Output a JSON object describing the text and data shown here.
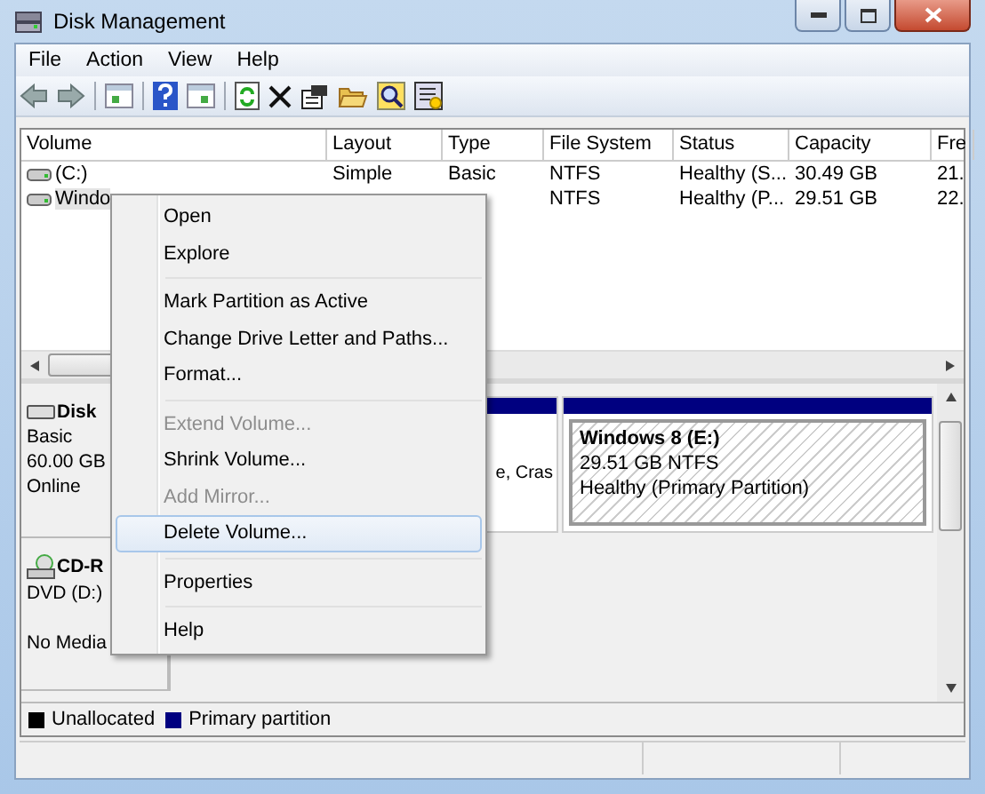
{
  "window": {
    "title": "Disk Management"
  },
  "menu": [
    "File",
    "Action",
    "View",
    "Help"
  ],
  "columns": [
    "Volume",
    "Layout",
    "Type",
    "File System",
    "Status",
    "Capacity",
    "Fre"
  ],
  "rows": [
    {
      "volume": "(C:)",
      "layout": "Simple",
      "type": "Basic",
      "file_system": "NTFS",
      "status": "Healthy (S...",
      "capacity": "30.49 GB",
      "free": "21.",
      "selected": false
    },
    {
      "volume": "Windo",
      "file_system": "NTFS",
      "status": "Healthy (P...",
      "capacity": "29.51 GB",
      "free": "22.",
      "selected": true
    }
  ],
  "disks": [
    {
      "kind": "disk",
      "name": "Disk",
      "type": "Basic",
      "size": "60.00 GB",
      "status": "Online",
      "partitions": [
        {
          "lines": [
            "e, Cras"
          ],
          "selected": false
        },
        {
          "name": "Windows 8  (E:)",
          "lines": [
            "29.51 GB NTFS",
            "Healthy (Primary Partition)"
          ],
          "selected": true
        }
      ]
    },
    {
      "kind": "cdrom",
      "name": "CD-R",
      "type": "DVD (D:)",
      "status": "No Media"
    }
  ],
  "legend": [
    {
      "label": "Unallocated",
      "color": "#000000"
    },
    {
      "label": "Primary partition",
      "color": "#000080"
    }
  ],
  "context_menu": [
    [
      {
        "label": "Open",
        "disabled": false,
        "selected": false
      },
      {
        "label": "Explore",
        "disabled": false,
        "selected": false
      }
    ],
    [
      {
        "label": "Mark Partition as Active",
        "disabled": false,
        "selected": false
      },
      {
        "label": "Change Drive Letter and Paths...",
        "disabled": false,
        "selected": false
      },
      {
        "label": "Format...",
        "disabled": false,
        "selected": false
      }
    ],
    [
      {
        "label": "Extend Volume...",
        "disabled": true,
        "selected": false
      },
      {
        "label": "Shrink Volume...",
        "disabled": false,
        "selected": false
      },
      {
        "label": "Add Mirror...",
        "disabled": true,
        "selected": false
      },
      {
        "label": "Delete Volume...",
        "disabled": false,
        "selected": true
      }
    ],
    [
      {
        "label": "Properties",
        "disabled": false,
        "selected": false
      }
    ],
    [
      {
        "label": "Help",
        "disabled": false,
        "selected": false
      }
    ]
  ]
}
